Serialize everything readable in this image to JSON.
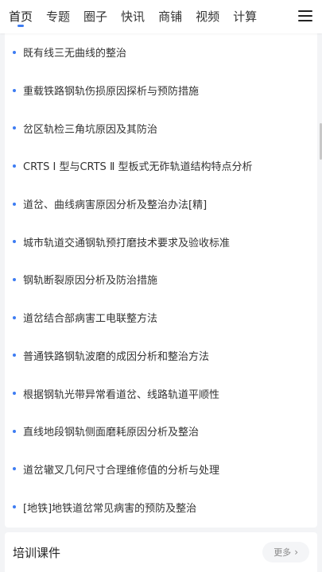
{
  "nav": {
    "items": [
      {
        "label": "首页"
      },
      {
        "label": "专题"
      },
      {
        "label": "圈子"
      },
      {
        "label": "快讯"
      },
      {
        "label": "商铺"
      },
      {
        "label": "视频"
      },
      {
        "label": "计算"
      }
    ],
    "active_index": 0
  },
  "articles": [
    "既有线三无曲线的整治",
    "重载铁路钢轨伤损原因探析与预防措施",
    "岔区轨检三角坑原因及其防治",
    "CRTS Ⅰ 型与CRTS Ⅱ 型板式无砟轨道结构特点分析",
    "道岔、曲线病害原因分析及整治办法[精]",
    "城市轨道交通钢轨预打磨技术要求及验收标准",
    "钢轨断裂原因分析及防治措施",
    "道岔结合部病害工电联整方法",
    "普通铁路钢轨波磨的成因分析和整治方法",
    "根据钢轨光带异常看道岔、线路轨道平顺性",
    "直线地段钢轨侧面磨耗原因分析及整治",
    "道岔辙叉几何尺寸合理维修值的分析与处理",
    "[地铁]地铁道岔常见病害的预防及整治"
  ],
  "section": {
    "title": "培训课件",
    "more_label": "更多"
  },
  "colors": {
    "accent": "#3d7cf2",
    "background": "#f3f4f6"
  }
}
